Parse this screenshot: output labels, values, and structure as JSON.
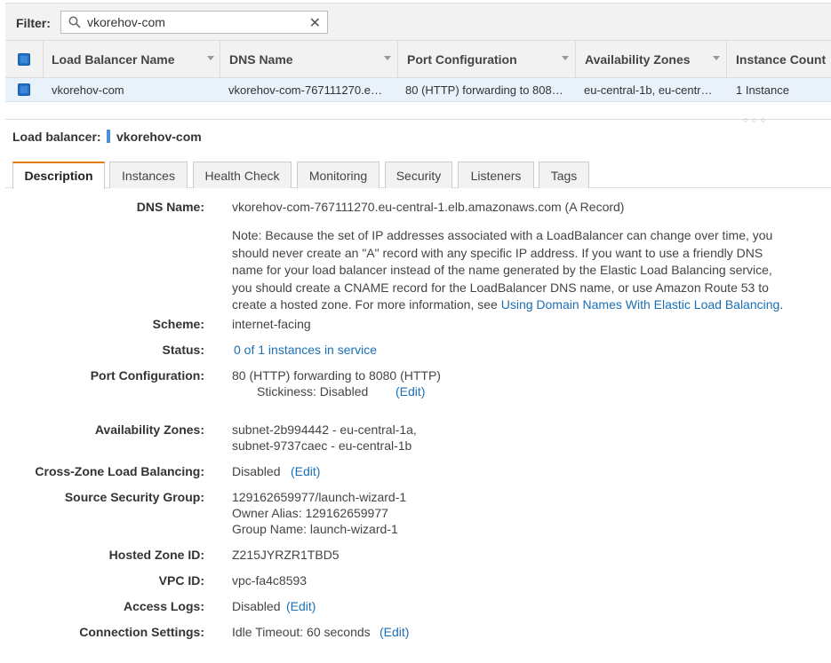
{
  "filter": {
    "label": "Filter:",
    "value": "vkorehov-com",
    "clear_symbol": "✕"
  },
  "grid": {
    "columns": [
      "Load Balancer Name",
      "DNS Name",
      "Port Configuration",
      "Availability Zones",
      "Instance Count"
    ],
    "rows": [
      {
        "name": "vkorehov-com",
        "dns": "vkorehov-com-767111270.e…",
        "port": "80 (HTTP) forwarding to 808…",
        "zones": "eu-central-1b, eu-centr…",
        "count": "1 Instance"
      }
    ]
  },
  "drag_handle": "○ ○ ○",
  "selected": {
    "title": "Load balancer:",
    "name": "vkorehov-com"
  },
  "tabs": [
    "Description",
    "Instances",
    "Health Check",
    "Monitoring",
    "Security",
    "Listeners",
    "Tags"
  ],
  "description": {
    "dns_label": "DNS Name:",
    "dns_value": "vkorehov-com-767111270.eu-central-1.elb.amazonaws.com (A Record)",
    "note_lines": [
      "Note: Because the set of IP addresses associated with a LoadBalancer can change over time, you",
      "should never create an \"A\" record with any specific IP address. If you want to use a friendly DNS",
      "name for your load balancer instead of the name generated by the Elastic Load Balancing service,",
      "you should create a CNAME record for the LoadBalancer DNS name, or use Amazon Route 53 to"
    ],
    "note_last_text": "create a hosted zone. For more information, see ",
    "note_link": "Using Domain Names With Elastic Load Balancing",
    "note_end": ".",
    "scheme_label": "Scheme:",
    "scheme_value": "internet-facing",
    "status_label": "Status:",
    "status_value": "0 of 1 instances in service",
    "port_label": "Port Configuration:",
    "port_value": "80 (HTTP) forwarding to 8080 (HTTP)",
    "stickiness": "Stickiness: Disabled",
    "edit": "(Edit)",
    "az_label": "Availability Zones:",
    "az_values": [
      "subnet-2b994442 - eu-central-1a,",
      "subnet-9737caec - eu-central-1b"
    ],
    "crosszone_label": "Cross-Zone Load Balancing:",
    "crosszone_value": "Disabled",
    "ssg_label": "Source Security Group:",
    "ssg_values": [
      "129162659977/launch-wizard-1",
      "Owner Alias: 129162659977",
      "Group Name: launch-wizard-1"
    ],
    "hz_label": "Hosted Zone ID:",
    "hz_value": "Z215JYRZR1TBD5",
    "vpc_label": "VPC ID:",
    "vpc_value": "vpc-fa4c8593",
    "logs_label": "Access Logs:",
    "logs_value": "Disabled",
    "conn_label": "Connection Settings:",
    "conn_value": "Idle Timeout: 60 seconds"
  },
  "colors": {
    "accent": "#e07b00",
    "link": "#1a6fb5",
    "checkbox": "#1f6fc5",
    "row_selected": "#e9f1fa"
  }
}
